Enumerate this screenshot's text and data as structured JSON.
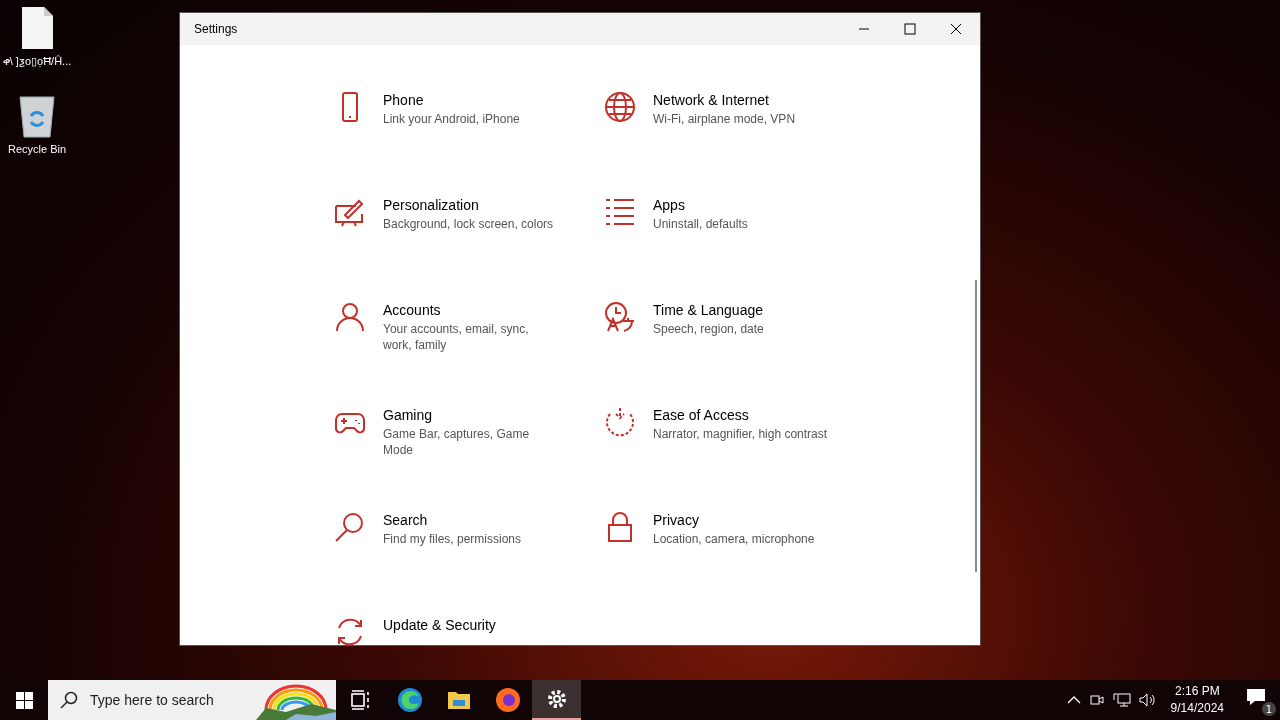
{
  "desktop_icons": [
    {
      "label": "ቀ\\ ]ƺo▯ọĦ/Ĥ..."
    },
    {
      "label": "Recycle Bin"
    }
  ],
  "window": {
    "title": "Settings"
  },
  "categories": [
    {
      "title": "Phone",
      "subtitle": "Link your Android, iPhone"
    },
    {
      "title": "Network & Internet",
      "subtitle": "Wi-Fi, airplane mode, VPN"
    },
    {
      "title": "Personalization",
      "subtitle": "Background, lock screen, colors"
    },
    {
      "title": "Apps",
      "subtitle": "Uninstall, defaults"
    },
    {
      "title": "Accounts",
      "subtitle": "Your accounts, email, sync, work, family"
    },
    {
      "title": "Time & Language",
      "subtitle": "Speech, region, date"
    },
    {
      "title": "Gaming",
      "subtitle": "Game Bar, captures, Game Mode"
    },
    {
      "title": "Ease of Access",
      "subtitle": "Narrator, magnifier, high contrast"
    },
    {
      "title": "Search",
      "subtitle": "Find my files, permissions"
    },
    {
      "title": "Privacy",
      "subtitle": "Location, camera, microphone"
    },
    {
      "title": "Update & Security"
    }
  ],
  "taskbar": {
    "search": {
      "placeholder": "Type here to search"
    },
    "apps": [
      {
        "selected": false
      },
      {
        "selected": false
      },
      {
        "selected": false
      },
      {
        "selected": false
      },
      {
        "selected": true
      }
    ],
    "time": "2:16 PM",
    "date": "9/14/2024",
    "notification_count": "1"
  }
}
